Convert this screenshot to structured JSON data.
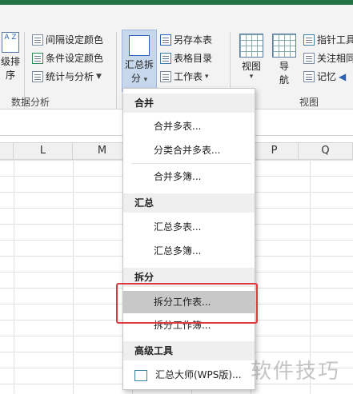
{
  "ribbon": {
    "left_partial_labels": [
      "级排",
      "序"
    ],
    "sort_icon_text": "A Z",
    "data_analysis": {
      "items": [
        "间隔设定颜色",
        "条件设定颜色",
        "统计与分析"
      ],
      "group_label": "数据分析"
    },
    "summary_split_button": {
      "line1": "汇总拆",
      "line2": "分"
    },
    "mid_items": [
      "另存本表",
      "表格目录",
      "工作表"
    ],
    "view_button": "视图",
    "nav_button": {
      "line1": "导",
      "line2": "航"
    },
    "right_items": [
      "指针工具",
      "关注相同",
      "记忆"
    ],
    "view_group_label": "视图"
  },
  "columns": [
    "L",
    "M",
    "P",
    "Q"
  ],
  "menu": {
    "sections": [
      {
        "title": "合并",
        "items": [
          "合并多表...",
          "分类合并多表...",
          "合并多簿..."
        ]
      },
      {
        "title": "汇总",
        "items": [
          "汇总多表...",
          "汇总多簿..."
        ]
      },
      {
        "title": "拆分",
        "items": [
          "拆分工作表...",
          "拆分工作簿..."
        ]
      },
      {
        "title": "高级工具",
        "items": [
          "汇总大师(WPS版)..."
        ]
      }
    ]
  },
  "watermark": "软件技巧",
  "colors": {
    "accent": "#217346",
    "highlight": "#e0393e",
    "selected_bg": "#c8c8c8"
  }
}
